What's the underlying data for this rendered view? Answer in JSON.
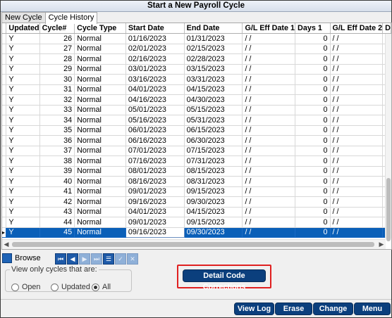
{
  "window": {
    "title": "Start a New Payroll Cycle"
  },
  "tabs": [
    {
      "label": "New Cycle"
    },
    {
      "label": "Cycle History"
    }
  ],
  "grid": {
    "columns": [
      "Updated",
      "Cycle#",
      "Cycle Type",
      "Start Date",
      "End Date",
      "G/L Eff Date 1",
      "Days 1",
      "G/L Eff Date 2",
      "D"
    ],
    "rows": [
      [
        "Y",
        "26",
        "Normal",
        "01/16/2023",
        "01/31/2023",
        " / /",
        "0",
        " / /"
      ],
      [
        "Y",
        "27",
        "Normal",
        "02/01/2023",
        "02/15/2023",
        " / /",
        "0",
        " / /"
      ],
      [
        "Y",
        "28",
        "Normal",
        "02/16/2023",
        "02/28/2023",
        " / /",
        "0",
        " / /"
      ],
      [
        "Y",
        "29",
        "Normal",
        "03/01/2023",
        "03/15/2023",
        " / /",
        "0",
        " / /"
      ],
      [
        "Y",
        "30",
        "Normal",
        "03/16/2023",
        "03/31/2023",
        " / /",
        "0",
        " / /"
      ],
      [
        "Y",
        "31",
        "Normal",
        "04/01/2023",
        "04/15/2023",
        " / /",
        "0",
        " / /"
      ],
      [
        "Y",
        "32",
        "Normal",
        "04/16/2023",
        "04/30/2023",
        " / /",
        "0",
        " / /"
      ],
      [
        "Y",
        "33",
        "Normal",
        "05/01/2023",
        "05/15/2023",
        " / /",
        "0",
        " / /"
      ],
      [
        "Y",
        "34",
        "Normal",
        "05/16/2023",
        "05/31/2023",
        " / /",
        "0",
        " / /"
      ],
      [
        "Y",
        "35",
        "Normal",
        "06/01/2023",
        "06/15/2023",
        " / /",
        "0",
        " / /"
      ],
      [
        "Y",
        "36",
        "Normal",
        "06/16/2023",
        "06/30/2023",
        " / /",
        "0",
        " / /"
      ],
      [
        "Y",
        "37",
        "Normal",
        "07/01/2023",
        "07/15/2023",
        " / /",
        "0",
        " / /"
      ],
      [
        "Y",
        "38",
        "Normal",
        "07/16/2023",
        "07/31/2023",
        " / /",
        "0",
        " / /"
      ],
      [
        "Y",
        "39",
        "Normal",
        "08/01/2023",
        "08/15/2023",
        " / /",
        "0",
        " / /"
      ],
      [
        "Y",
        "40",
        "Normal",
        "08/16/2023",
        "08/31/2023",
        " / /",
        "0",
        " / /"
      ],
      [
        "Y",
        "41",
        "Normal",
        "09/01/2023",
        "09/15/2023",
        " / /",
        "0",
        " / /"
      ],
      [
        "Y",
        "42",
        "Normal",
        "09/16/2023",
        "09/30/2023",
        " / /",
        "0",
        " / /"
      ],
      [
        "Y",
        "43",
        "Normal",
        "04/01/2023",
        "04/15/2023",
        " / /",
        "0",
        " / /"
      ],
      [
        "Y",
        "44",
        "Normal",
        "09/01/2023",
        "09/15/2023",
        " / /",
        "0",
        " / /"
      ],
      [
        "Y",
        "45",
        "Normal",
        "09/16/2023",
        "09/30/2023",
        " / /",
        "0",
        " / /"
      ]
    ]
  },
  "browse": {
    "label": "Browse"
  },
  "filter": {
    "legend": "View only cycles that are:",
    "options": [
      "Open",
      "Updated",
      "All"
    ]
  },
  "buttons": {
    "detail_code_corrections": "Detail Code Corrections",
    "view_log": "View Log",
    "erase": "Erase",
    "change": "Change",
    "menu": "Menu"
  }
}
